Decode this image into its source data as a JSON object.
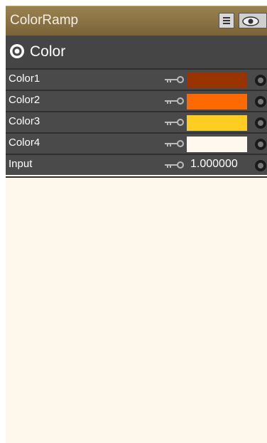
{
  "node": {
    "title": "ColorRamp",
    "icons": {
      "menu": "menu-icon",
      "visibility": "eye-icon"
    }
  },
  "section": {
    "label": "Color",
    "icon": "target-icon"
  },
  "rows": [
    {
      "label": "Color1",
      "color": "#993300"
    },
    {
      "label": "Color2",
      "color": "#ff6a00"
    },
    {
      "label": "Color3",
      "color": "#ffcc22"
    },
    {
      "label": "Color4",
      "color": "#fff8ee"
    },
    {
      "label": "Input",
      "value": "1.000000"
    }
  ],
  "colors": {
    "panel_background": "#fdf7ec",
    "title_bar": "#8a7244",
    "row_background": "#4a4a4a"
  }
}
